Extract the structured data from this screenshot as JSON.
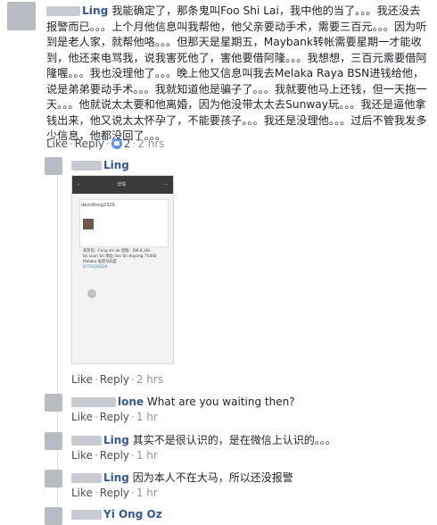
{
  "comments": [
    {
      "name": "Ling",
      "text": "我能确定了，那条鬼叫Foo Shi Lai，我中他的当了。。。我还没去报警而已。。。上个月他信息叫我帮他，他父亲要动手术，需要三百元。。。因为听到是老人家，就帮他咯。。。但那天是星期五，Maybank转帐需要星期一才能收到，他还来电骂我，说我害死他了，害他要借阿隆。。。我想想，三百元需要借阿隆喔。。。我也没理他了。。。晚上他又信息叫我去Melaka Raya BSN进钱给他，说是弟弟要动手术。。。我就知道他是骗子了。。。我就要他马上还钱，但一天拖一天。。。他就说太太要和他离婚，因为他没带太太去Sunway玩。。。我还是逼他拿钱出来，他又说太太怀孕了，不能要孩子。。。我还是没理他。。。过后不管我发多少信息，他都没回了。。。",
      "like": "Like",
      "reply": "Reply",
      "reactions": "2",
      "time": "2 hrs"
    }
  ],
  "replies": [
    {
      "name": "Ling",
      "text": "",
      "like": "Like",
      "reply": "Reply",
      "time": "2 hrs"
    },
    {
      "name": "lone",
      "text": "What are you waiting then?",
      "like": "Like",
      "reply": "Reply",
      "time": "1 hr"
    },
    {
      "name": "Ling",
      "text": "其实不是很认识的，是在微信上认识的。。。",
      "like": "Like",
      "reply": "Reply",
      "time": "1 hr"
    },
    {
      "name": "Ling",
      "text": "因为本人不在大马，所以还没报警",
      "like": "Like",
      "reply": "Reply",
      "time": "1 hr"
    },
    {
      "name": "Yi Ong Oz",
      "text": ""
    }
  ],
  "phone": {
    "header_center": "详情",
    "username": "davidfong2329",
    "message_1": "或罗塔：Fong shi lai 借款：RM 8,30k",
    "message_2": "bk Loan Sri 地址 ilan Sri duyong 75460 Melaka 电话号码是",
    "account_highlight": "0770320026"
  },
  "colors": {
    "link": "#365899",
    "meta": "#90949c",
    "reaction": "#5890ff"
  }
}
